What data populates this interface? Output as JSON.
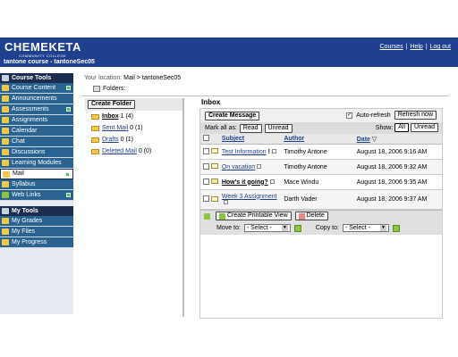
{
  "header": {
    "logo": "CHEMEKETA",
    "logo_sub": "COMMUNITY COLLEGE",
    "course_title": "tantone course - tantoneSec05",
    "links": [
      "Courses",
      "Help",
      "Log out"
    ]
  },
  "sidebar": {
    "course_tools_title": "Course Tools",
    "course_tools": [
      {
        "label": "Course Content",
        "icon": "content-icon",
        "new": true
      },
      {
        "label": "Announcements",
        "icon": "announcements-icon",
        "new": false
      },
      {
        "label": "Assessments",
        "icon": "assessments-icon",
        "new": true
      },
      {
        "label": "Assignments",
        "icon": "assignments-icon",
        "new": false
      },
      {
        "label": "Calendar",
        "icon": "calendar-icon",
        "new": false
      },
      {
        "label": "Chat",
        "icon": "chat-icon",
        "new": false
      },
      {
        "label": "Discussions",
        "icon": "discussions-icon",
        "new": false
      },
      {
        "label": "Learning Modules",
        "icon": "modules-icon",
        "new": false
      },
      {
        "label": "Mail",
        "icon": "mail-icon",
        "new": true,
        "active": true
      },
      {
        "label": "Syllabus",
        "icon": "syllabus-icon",
        "new": false
      },
      {
        "label": "Web Links",
        "icon": "weblinks-icon",
        "new": true
      }
    ],
    "my_tools_title": "My Tools",
    "my_tools": [
      {
        "label": "My Grades",
        "icon": "grades-icon"
      },
      {
        "label": "My Files",
        "icon": "files-icon"
      },
      {
        "label": "My Progress",
        "icon": "progress-icon"
      }
    ]
  },
  "location": {
    "prefix": "Your location:",
    "path": "Mail > tantoneSec05",
    "folders_label": "Folders:"
  },
  "folders": {
    "create_label": "Create Folder",
    "items": [
      {
        "name": "Inbox",
        "count": "1 (4)",
        "selected": true
      },
      {
        "name": "Sent Mail",
        "count": "0 (1)"
      },
      {
        "name": "Drafts",
        "count": "0 (1)"
      },
      {
        "name": "Deleted Mail",
        "count": "0 (0)"
      }
    ]
  },
  "inbox": {
    "title": "Inbox",
    "create_message": "Create Message",
    "auto_refresh": "Auto-refresh",
    "refresh_now": "Refresh now",
    "mark_all_as": "Mark all as:",
    "mark_read": "Read",
    "mark_unread": "Unread",
    "show_label": "Show:",
    "show_all": "All",
    "show_unread": "Unread",
    "col_subject": "Subject",
    "col_author": "Author",
    "col_date": "Date",
    "messages": [
      {
        "subject": "Test Information",
        "author": "Timothy Antone",
        "date": "August 18, 2006 9:16 AM",
        "unread": false,
        "flag": "!"
      },
      {
        "subject": "On vacation",
        "author": "Timothy Antone",
        "date": "August 18, 2006 9:32 AM",
        "unread": false
      },
      {
        "subject": "How's it going?",
        "author": "Mace Windu",
        "date": "August 18, 2006 9:35 AM",
        "unread": true
      },
      {
        "subject": "Week 3 Assignment",
        "author": "Darth Vader",
        "date": "August 18, 2006 9:37 AM",
        "unread": false
      }
    ],
    "printable_view": "Create Printable View",
    "delete": "Delete",
    "move_to": "Move to:",
    "copy_to": "Copy to:",
    "select_placeholder": "- Select -"
  }
}
